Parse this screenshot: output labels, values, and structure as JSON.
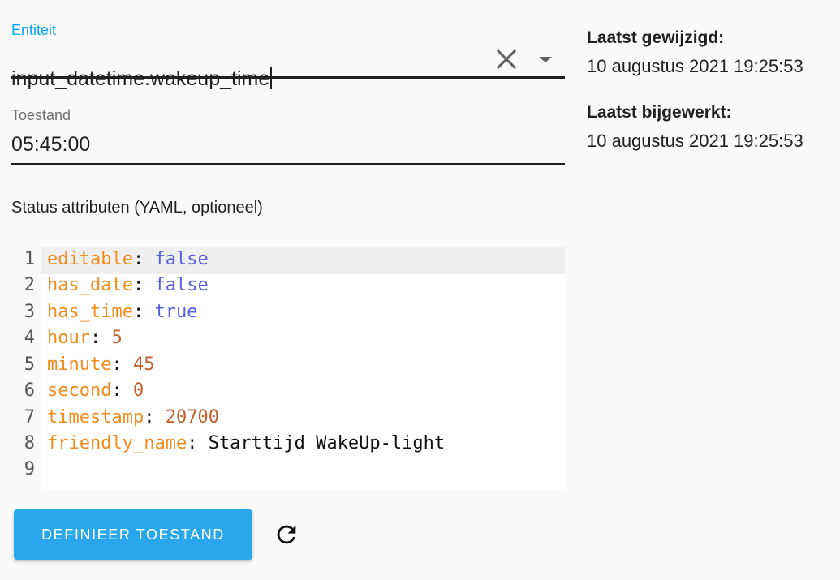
{
  "entity_field": {
    "label": "Entiteit",
    "value": "input_datetime.wakeup_time",
    "clear_icon": "close-icon",
    "dropdown_icon": "arrow-drop-down-icon"
  },
  "state_field": {
    "label": "Toestand",
    "value": "05:45:00"
  },
  "attributes_label": "Status attributen (YAML, optioneel)",
  "editor": {
    "line_numbers": [
      "1",
      "2",
      "3",
      "4",
      "5",
      "6",
      "7",
      "8",
      "9"
    ],
    "lines": [
      {
        "key": "editable",
        "value": "false",
        "kind": "bool"
      },
      {
        "key": "has_date",
        "value": "false",
        "kind": "bool"
      },
      {
        "key": "has_time",
        "value": "true",
        "kind": "bool"
      },
      {
        "key": "hour",
        "value": "5",
        "kind": "number"
      },
      {
        "key": "minute",
        "value": "45",
        "kind": "number"
      },
      {
        "key": "second",
        "value": "0",
        "kind": "number"
      },
      {
        "key": "timestamp",
        "value": "20700",
        "kind": "number"
      },
      {
        "key": "friendly_name",
        "value": "Starttijd WakeUp-light",
        "kind": "string"
      },
      {
        "key": "",
        "value": "",
        "kind": "empty"
      }
    ]
  },
  "actions": {
    "set_state_label": "DEFINIEER TOESTAND",
    "refresh_icon": "refresh-icon"
  },
  "info": {
    "last_changed_label": "Laatst gewijzigd:",
    "last_changed_value": "10 augustus 2021 19:25:53",
    "last_updated_label": "Laatst bijgewerkt:",
    "last_updated_value": "10 augustus 2021 19:25:53"
  },
  "colors": {
    "accent": "#03a9f4",
    "button": "#2aa7ea",
    "yaml_key": "#f28c1d",
    "yaml_bool": "#5960e0",
    "yaml_number": "#c0622f"
  }
}
